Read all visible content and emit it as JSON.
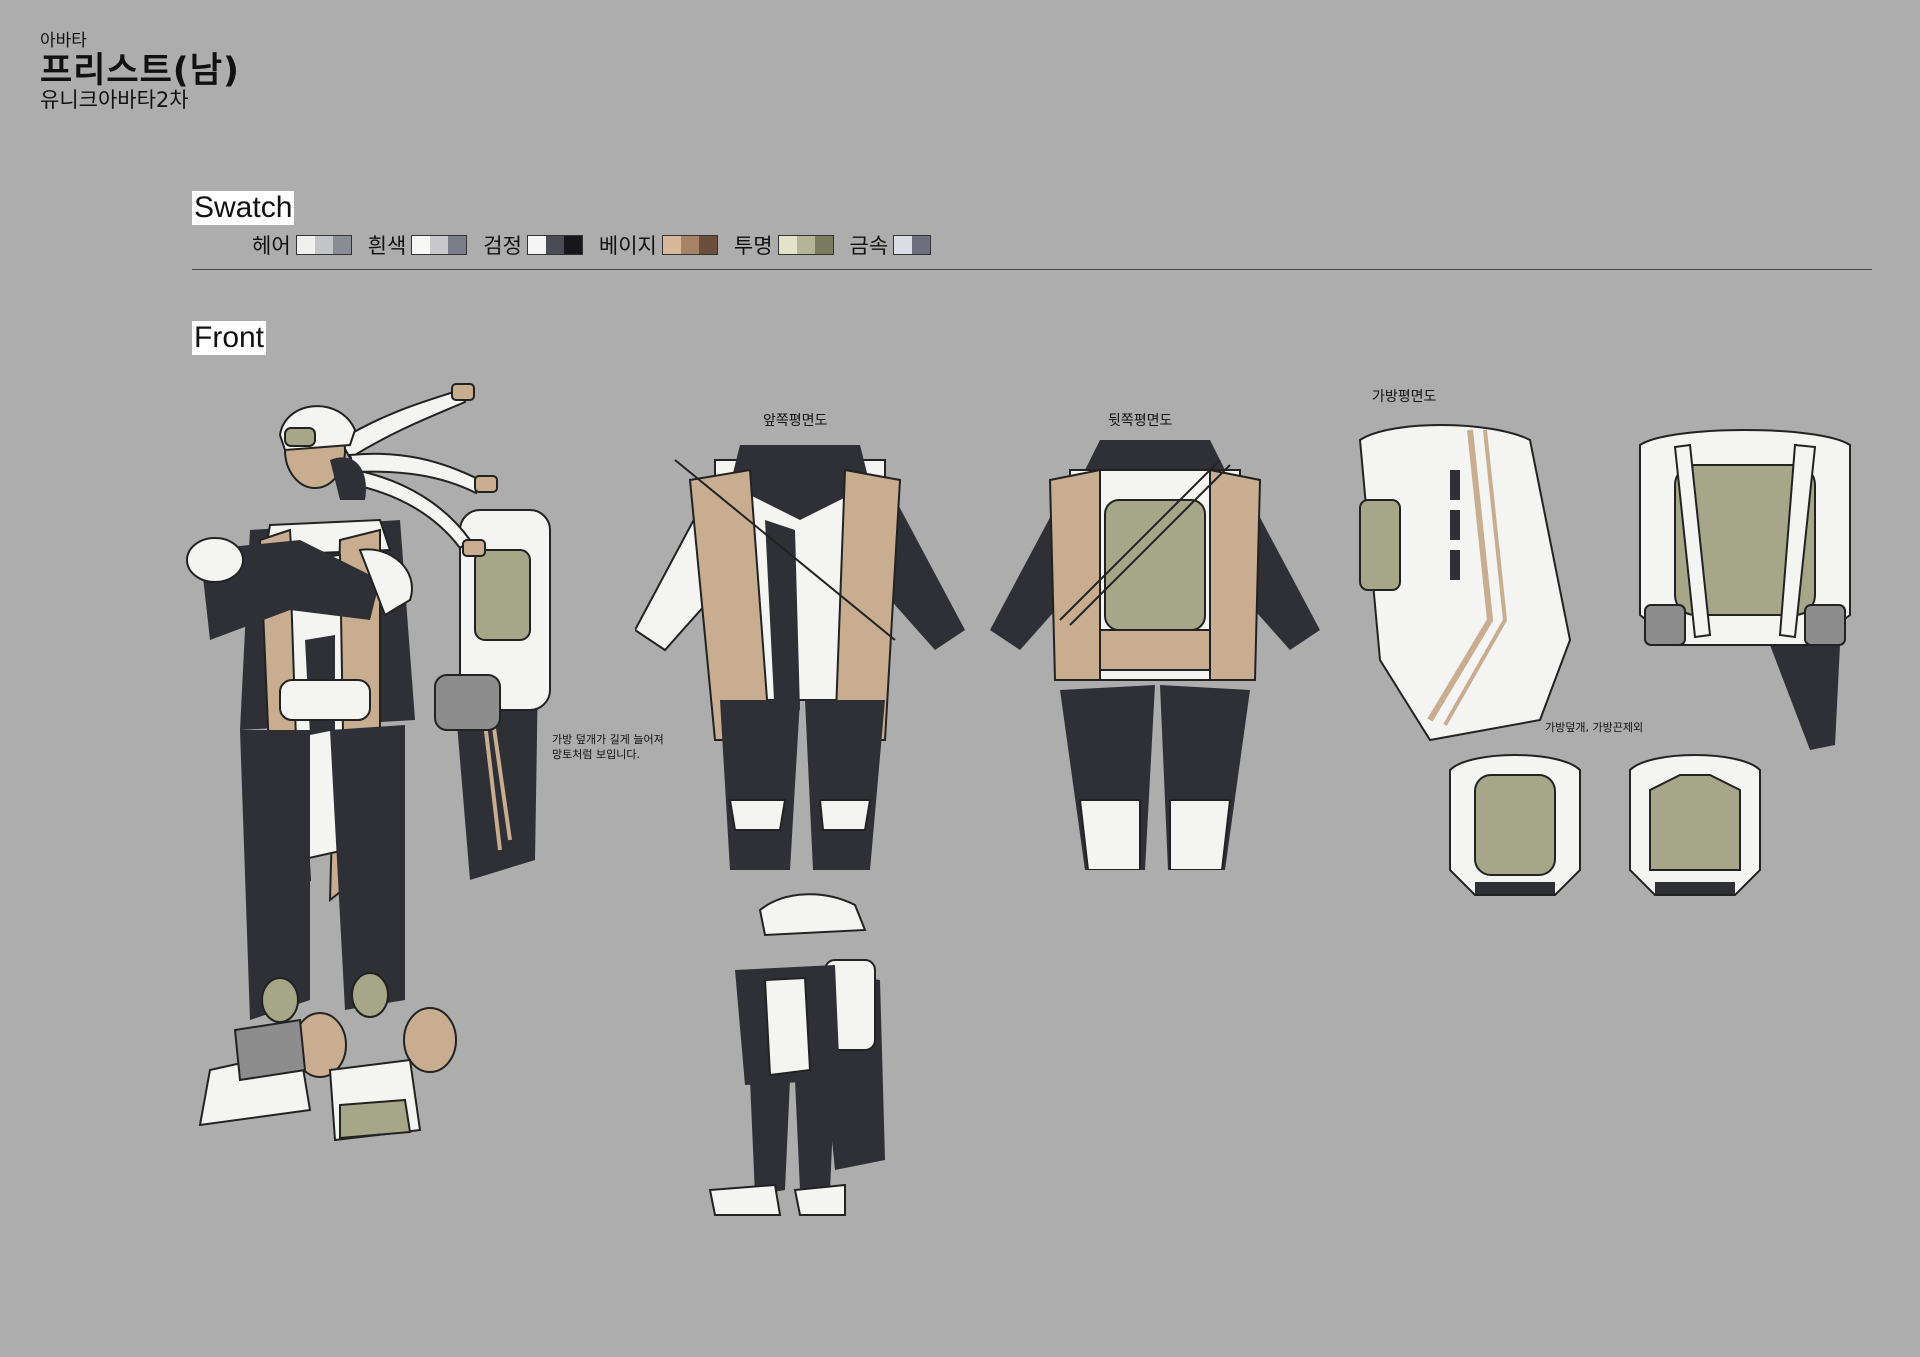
{
  "header": {
    "category": "아바타",
    "title": "프리스트(남)",
    "subtitle": "유니크아바타2차"
  },
  "swatch": {
    "heading": "Swatch",
    "groups": [
      {
        "name": "헤어",
        "colors": [
          "#f0f0ef",
          "#c3c4c6",
          "#8a8d94"
        ]
      },
      {
        "name": "흰색",
        "colors": [
          "#f7f7f6",
          "#c8c8cc",
          "#7b7d88"
        ]
      },
      {
        "name": "검정",
        "colors": [
          "#f5f5f5",
          "#4b4b55",
          "#17171b"
        ]
      },
      {
        "name": "베이지",
        "colors": [
          "#d7b89a",
          "#a68366",
          "#6b4e3b"
        ]
      },
      {
        "name": "투명",
        "colors": [
          "#e2e3c8",
          "#b4b596",
          "#7a7c60"
        ]
      },
      {
        "name": "금속",
        "colors": [
          "#dcdce4",
          "#6e6e7e"
        ]
      }
    ]
  },
  "front": {
    "heading": "Front",
    "captions": {
      "front_view": "앞쪽평면도",
      "back_view": "뒷쪽평면도",
      "bag_view": "가방평면도",
      "bag_lid_note": "가방덮개, 가방끈제외"
    },
    "main_note_line1": "가방 덮개가 길게 늘어져",
    "main_note_line2": "망토처럼 보입니다."
  },
  "palette": {
    "background": "#adadad",
    "black": "#2f2f36",
    "white": "#f4f4f2",
    "beige": "#c9ad90",
    "olive": "#a6a689"
  }
}
